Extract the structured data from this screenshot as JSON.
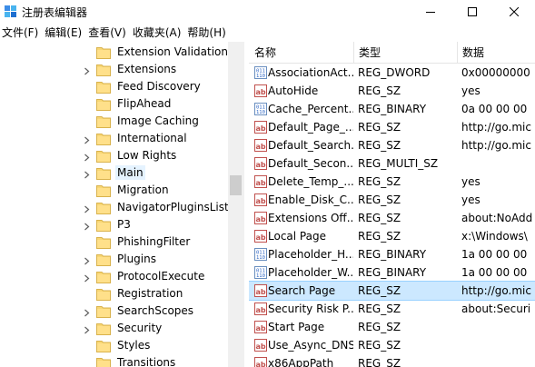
{
  "window": {
    "title": "注册表编辑器",
    "colors": {
      "accent": "#0078d7",
      "selection": "#cce8ff",
      "tree_selection": "#e5f3ff",
      "folder": "#f8d775"
    }
  },
  "menu": [
    "文件(F)",
    "编辑(E)",
    "查看(V)",
    "收藏夹(A)",
    "帮助(H)"
  ],
  "tree": {
    "items": [
      {
        "label": "Extension Validation",
        "expandable": false,
        "selected": false
      },
      {
        "label": "Extensions",
        "expandable": true,
        "selected": false
      },
      {
        "label": "Feed Discovery",
        "expandable": false,
        "selected": false
      },
      {
        "label": "FlipAhead",
        "expandable": false,
        "selected": false
      },
      {
        "label": "Image Caching",
        "expandable": false,
        "selected": false
      },
      {
        "label": "International",
        "expandable": true,
        "selected": false
      },
      {
        "label": "Low Rights",
        "expandable": true,
        "selected": false
      },
      {
        "label": "Main",
        "expandable": true,
        "selected": true
      },
      {
        "label": "Migration",
        "expandable": false,
        "selected": false
      },
      {
        "label": "NavigatorPluginsList",
        "expandable": true,
        "selected": false
      },
      {
        "label": "P3",
        "expandable": true,
        "selected": false
      },
      {
        "label": "PhishingFilter",
        "expandable": false,
        "selected": false
      },
      {
        "label": "Plugins",
        "expandable": true,
        "selected": false
      },
      {
        "label": "ProtocolExecute",
        "expandable": true,
        "selected": false
      },
      {
        "label": "Registration",
        "expandable": false,
        "selected": false
      },
      {
        "label": "SearchScopes",
        "expandable": true,
        "selected": false
      },
      {
        "label": "Security",
        "expandable": true,
        "selected": false
      },
      {
        "label": "Styles",
        "expandable": false,
        "selected": false
      },
      {
        "label": "Transitions",
        "expandable": false,
        "selected": false
      }
    ]
  },
  "values": {
    "headers": {
      "name": "名称",
      "type": "类型",
      "data": "数据"
    },
    "rows": [
      {
        "kind": "binary",
        "name": "AssociationAct...",
        "type": "REG_DWORD",
        "data": "0x00000000",
        "selected": false
      },
      {
        "kind": "string",
        "name": "AutoHide",
        "type": "REG_SZ",
        "data": "yes",
        "selected": false
      },
      {
        "kind": "binary",
        "name": "Cache_Percent...",
        "type": "REG_BINARY",
        "data": "0a 00 00 00",
        "selected": false
      },
      {
        "kind": "string",
        "name": "Default_Page_...",
        "type": "REG_SZ",
        "data": "http://go.mic",
        "selected": false
      },
      {
        "kind": "string",
        "name": "Default_Search...",
        "type": "REG_SZ",
        "data": "http://go.mic",
        "selected": false
      },
      {
        "kind": "string",
        "name": "Default_Secon...",
        "type": "REG_MULTI_SZ",
        "data": "",
        "selected": false
      },
      {
        "kind": "string",
        "name": "Delete_Temp_...",
        "type": "REG_SZ",
        "data": "yes",
        "selected": false
      },
      {
        "kind": "string",
        "name": "Enable_Disk_C...",
        "type": "REG_SZ",
        "data": "yes",
        "selected": false
      },
      {
        "kind": "string",
        "name": "Extensions Off...",
        "type": "REG_SZ",
        "data": "about:NoAdd",
        "selected": false
      },
      {
        "kind": "string",
        "name": "Local Page",
        "type": "REG_SZ",
        "data": "x:\\Windows\\",
        "selected": false
      },
      {
        "kind": "binary",
        "name": "Placeholder_H...",
        "type": "REG_BINARY",
        "data": "1a 00 00 00",
        "selected": false
      },
      {
        "kind": "binary",
        "name": "Placeholder_W...",
        "type": "REG_BINARY",
        "data": "1a 00 00 00",
        "selected": false
      },
      {
        "kind": "string",
        "name": "Search Page",
        "type": "REG_SZ",
        "data": "http://go.mic",
        "selected": true
      },
      {
        "kind": "string",
        "name": "Security Risk P...",
        "type": "REG_SZ",
        "data": "about:Securi",
        "selected": false
      },
      {
        "kind": "string",
        "name": "Start Page",
        "type": "REG_SZ",
        "data": "",
        "selected": false
      },
      {
        "kind": "string",
        "name": "Use_Async_DNS",
        "type": "REG_SZ",
        "data": "",
        "selected": false
      },
      {
        "kind": "string",
        "name": "x86AppPath",
        "type": "REG_SZ",
        "data": "",
        "selected": false
      }
    ]
  }
}
